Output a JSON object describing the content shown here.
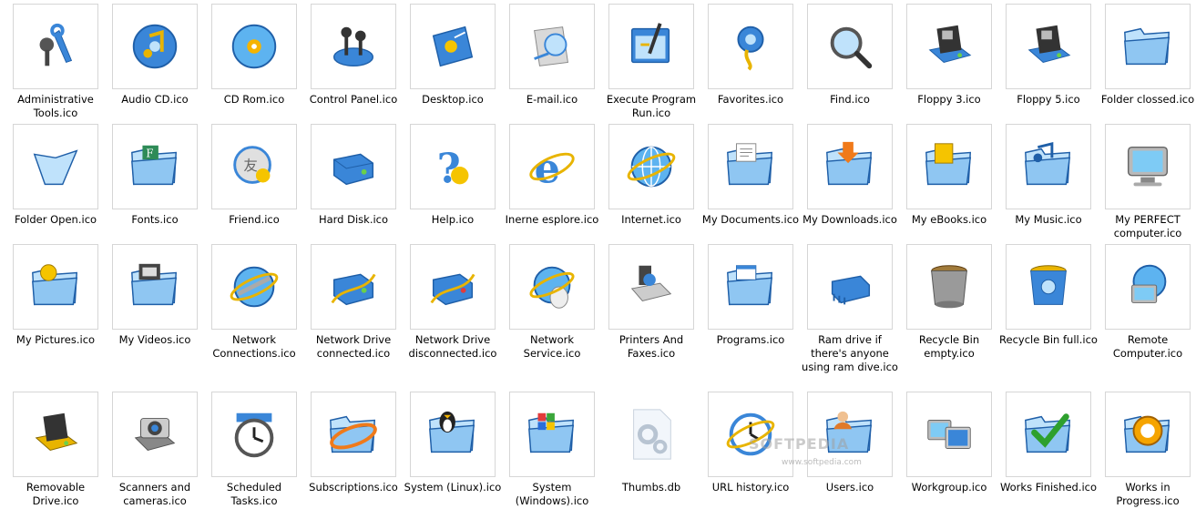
{
  "colors": {
    "icon_blue": "#3a86d8",
    "icon_light": "#bfe2fb",
    "border": "#d6d6d6"
  },
  "icons": [
    {
      "label": "Administrative Tools.ico",
      "icon": "tools-icon"
    },
    {
      "label": "Audio CD.ico",
      "icon": "audio-cd-icon"
    },
    {
      "label": "CD Rom.ico",
      "icon": "cd-rom-icon"
    },
    {
      "label": "Control Panel.ico",
      "icon": "control-panel-icon"
    },
    {
      "label": "Desktop.ico",
      "icon": "desktop-icon"
    },
    {
      "label": "E-mail.ico",
      "icon": "email-icon"
    },
    {
      "label": "Execute Program Run.ico",
      "icon": "run-icon"
    },
    {
      "label": "Favorites.ico",
      "icon": "favorites-icon"
    },
    {
      "label": "Find.ico",
      "icon": "find-icon"
    },
    {
      "label": "Floppy 3.ico",
      "icon": "floppy-icon"
    },
    {
      "label": "Floppy 5.ico",
      "icon": "floppy-icon"
    },
    {
      "label": "Folder clossed.ico",
      "icon": "folder-icon"
    },
    {
      "label": "Folder Open.ico",
      "icon": "folder-open-icon"
    },
    {
      "label": "Fonts.ico",
      "icon": "fonts-folder-icon"
    },
    {
      "label": "Friend.ico",
      "icon": "friend-icon"
    },
    {
      "label": "Hard Disk.ico",
      "icon": "hard-disk-icon"
    },
    {
      "label": "Help.ico",
      "icon": "help-icon"
    },
    {
      "label": "Inerne esplore.ico",
      "icon": "internet-explorer-icon"
    },
    {
      "label": "Internet.ico",
      "icon": "globe-icon"
    },
    {
      "label": "My Documents.ico",
      "icon": "documents-folder-icon"
    },
    {
      "label": "My Downloads.ico",
      "icon": "downloads-folder-icon"
    },
    {
      "label": "My eBooks.ico",
      "icon": "ebooks-folder-icon"
    },
    {
      "label": "My Music.ico",
      "icon": "music-folder-icon"
    },
    {
      "label": "My PERFECT computer.ico",
      "icon": "computer-icon"
    },
    {
      "label": "My Pictures.ico",
      "icon": "pictures-folder-icon"
    },
    {
      "label": "My Videos.ico",
      "icon": "videos-folder-icon"
    },
    {
      "label": "Network Connections.ico",
      "icon": "network-connections-icon"
    },
    {
      "label": "Network Drive connected.ico",
      "icon": "network-drive-icon"
    },
    {
      "label": "Network Drive disconnected.ico",
      "icon": "network-drive-disconnected-icon"
    },
    {
      "label": "Network Service.ico",
      "icon": "network-service-icon"
    },
    {
      "label": "Printers And Faxes.ico",
      "icon": "printer-icon"
    },
    {
      "label": "Programs.ico",
      "icon": "programs-folder-icon"
    },
    {
      "label": "Ram drive if there's anyone using ram dive.ico",
      "icon": "ram-drive-icon"
    },
    {
      "label": "Recycle Bin empty.ico",
      "icon": "recycle-bin-empty-icon"
    },
    {
      "label": "Recycle Bin full.ico",
      "icon": "recycle-bin-full-icon"
    },
    {
      "label": "Remote Computer.ico",
      "icon": "remote-computer-icon"
    },
    {
      "label": "Removable Drive.ico",
      "icon": "removable-drive-icon"
    },
    {
      "label": "Scanners and cameras.ico",
      "icon": "camera-icon"
    },
    {
      "label": "Scheduled Tasks.ico",
      "icon": "clock-icon"
    },
    {
      "label": "Subscriptions.ico",
      "icon": "subscriptions-icon"
    },
    {
      "label": "System (Linux).ico",
      "icon": "linux-folder-icon"
    },
    {
      "label": "System (Windows).ico",
      "icon": "windows-folder-icon"
    },
    {
      "label": "Thumbs.db",
      "icon": "settings-file-icon"
    },
    {
      "label": "URL history.ico",
      "icon": "url-history-icon"
    },
    {
      "label": "Users.ico",
      "icon": "users-folder-icon"
    },
    {
      "label": "Workgroup.ico",
      "icon": "workgroup-icon"
    },
    {
      "label": "Works Finished.ico",
      "icon": "checkmark-folder-icon"
    },
    {
      "label": "Works in Progress.ico",
      "icon": "progress-folder-icon"
    }
  ],
  "watermark": {
    "text": "SOFTPEDIA",
    "sub": "www.softpedia.com"
  }
}
